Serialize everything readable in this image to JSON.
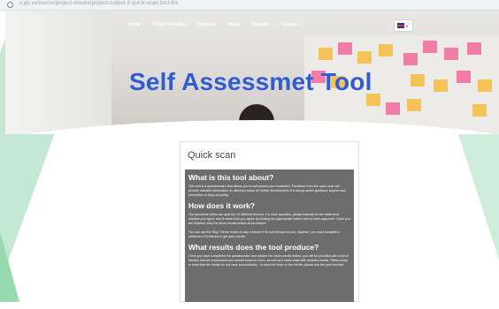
{
  "browser": {
    "url": "x.pp.xx/xxx/xx/project-results/project-output-2-quick-scan-tool-thx",
    "info_icon": "info-icon"
  },
  "nav": {
    "items": [
      "Home",
      "Project Results",
      "Partners",
      "News",
      "Register",
      "Contact"
    ]
  },
  "language": {
    "flag_icon": "uk-flag-icon",
    "caret": "▾"
  },
  "hero": {
    "title": "Self Assessmet Tool"
  },
  "card": {
    "title": "Quick scan",
    "sections": [
      {
        "heading": "What is this tool about?",
        "paragraphs": [
          "This tool is a questionnaire that allows you to self-assess your institution. Feedback from the quick scan will provide valuable information on attention areas for further development of a strong career guidance support and prevention of drop-out policy."
        ]
      },
      {
        "heading": "How does it work?",
        "paragraphs": [
          "The questions below are split into 12 different themes. For each question, please indicate for the statement whether you agree and to what level you agree by clicking the appropriate button next to each argument. Once you are finished, click the show results button at the bottom.",
          "You can use the Skip Theme button to skip a theme if it's not relevant to you, however, you must complete a minimum of 8 themes to get your results."
        ]
      },
      {
        "heading": "What results does the tool produce?",
        "paragraphs": [
          "Once you have completed the questionnaire and clicked the show results button, you will be provided with a list of themes that we recommend you should focus on more, as well as a radar chart with detailed results. Please keep in mind that the results do not save automatically - to save the chart or the full list, please use the print function."
        ]
      }
    ]
  },
  "colors": {
    "title_blue": "#2f5bd3",
    "panel_gray": "#6c6c6c",
    "green_accent": "#bfe6cf"
  }
}
